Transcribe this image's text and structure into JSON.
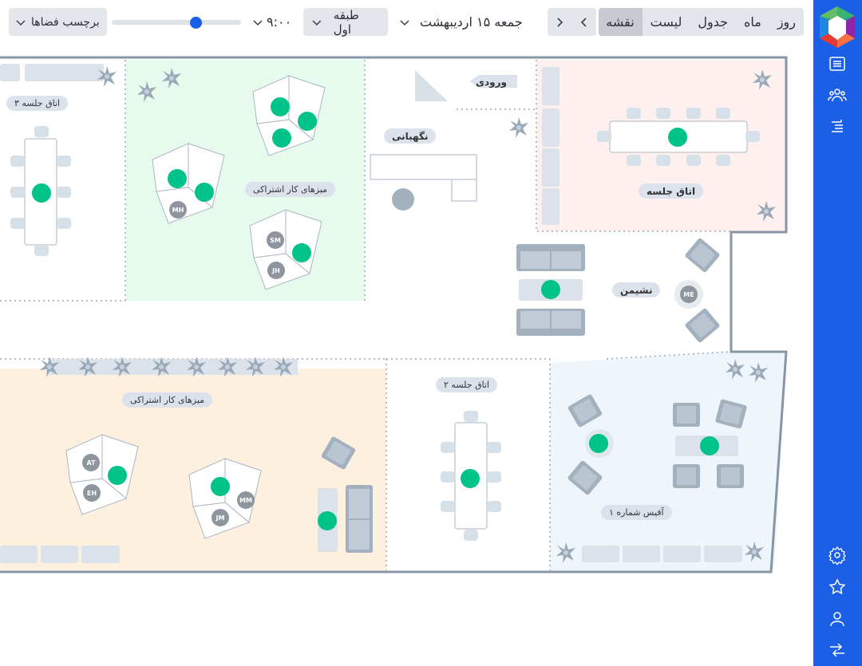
{
  "toolbar": {
    "view_tabs": [
      "روز",
      "ماه",
      "جدول",
      "لیست",
      "نقشه"
    ],
    "active_tab": "نقشه",
    "date": "جمعه ۱۵ اردیبهشت",
    "floor": "طبقه اول",
    "time": "۹:۰۰",
    "time_slider_level": 0.65,
    "space_labels": "برچسب فضاها"
  },
  "sidebar": {
    "top_icons": [
      "list-icon",
      "users-icon",
      "schedule-icon"
    ],
    "bottom_icons": [
      "settings-icon",
      "star-icon",
      "user-icon",
      "preferences-icon"
    ]
  },
  "map": {
    "labels": {
      "meeting_room_3": "اتاق جلسه ۳",
      "shared_desks_top": "میزهای کار اشتراکی",
      "entrance": "ورودی",
      "reception": "نگهبانی",
      "meeting_room": "اتاق جلسه",
      "lounge": "نشیمن",
      "shared_desks_bottom": "میزهای کار اشتراکی",
      "meeting_room_2": "اتاق جلسه ۲",
      "office_1": "آفیس شماره ۱"
    },
    "seat_codes": [
      "MH",
      "SM",
      "JH",
      "ME",
      "AT",
      "EH",
      "MM",
      "JM"
    ],
    "colors": {
      "available": "#00c389",
      "meeting_room_bg": "#fdf0ef",
      "shared_top_bg": "#e6faee",
      "shared_bottom_bg": "#fdf0de",
      "office_bg": "#eef6fb",
      "wall": "#8796a6"
    }
  }
}
